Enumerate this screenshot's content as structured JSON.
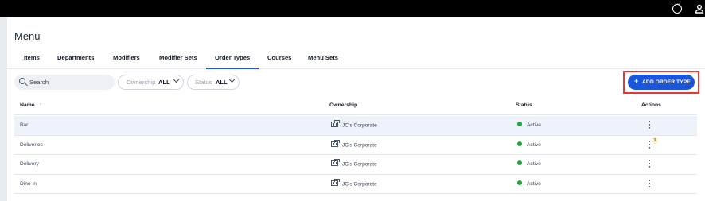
{
  "topbar": {
    "icons": [
      "chat-bubble-icon",
      "user-icon"
    ]
  },
  "page": {
    "title": "Menu"
  },
  "tabs": [
    {
      "label": "Items",
      "active": false
    },
    {
      "label": "Departments",
      "active": false
    },
    {
      "label": "Modifiers",
      "active": false
    },
    {
      "label": "Modifier Sets",
      "active": false
    },
    {
      "label": "Order Types",
      "active": true
    },
    {
      "label": "Courses",
      "active": false
    },
    {
      "label": "Menu Sets",
      "active": false
    }
  ],
  "toolbar": {
    "search_placeholder": "Search",
    "ownership_filter": {
      "label": "Ownership",
      "value": "ALL"
    },
    "status_filter": {
      "label": "Status",
      "value": "ALL"
    },
    "add_button_label": "ADD ORDER TYPE",
    "add_button_icon": "+"
  },
  "table": {
    "headers": {
      "name": "Name",
      "sort_arrow": "↑",
      "ownership": "Ownership",
      "status": "Status",
      "actions": "Actions"
    },
    "rows": [
      {
        "name": "Bar",
        "ownership": "JC's Corporate",
        "status": "Active",
        "badge": ""
      },
      {
        "name": "Deliveries",
        "ownership": "JC's Corporate",
        "status": "Active",
        "badge": "1"
      },
      {
        "name": "Delivery",
        "ownership": "JC's Corporate",
        "status": "Active",
        "badge": ""
      },
      {
        "name": "Dine In",
        "ownership": "JC's Corporate",
        "status": "Active",
        "badge": ""
      }
    ]
  },
  "colors": {
    "topbar": "#000000",
    "accent": "#1a56db",
    "highlight_border": "#e53935",
    "status_active": "#22a33a",
    "row_highlight": "#eef3fb"
  }
}
